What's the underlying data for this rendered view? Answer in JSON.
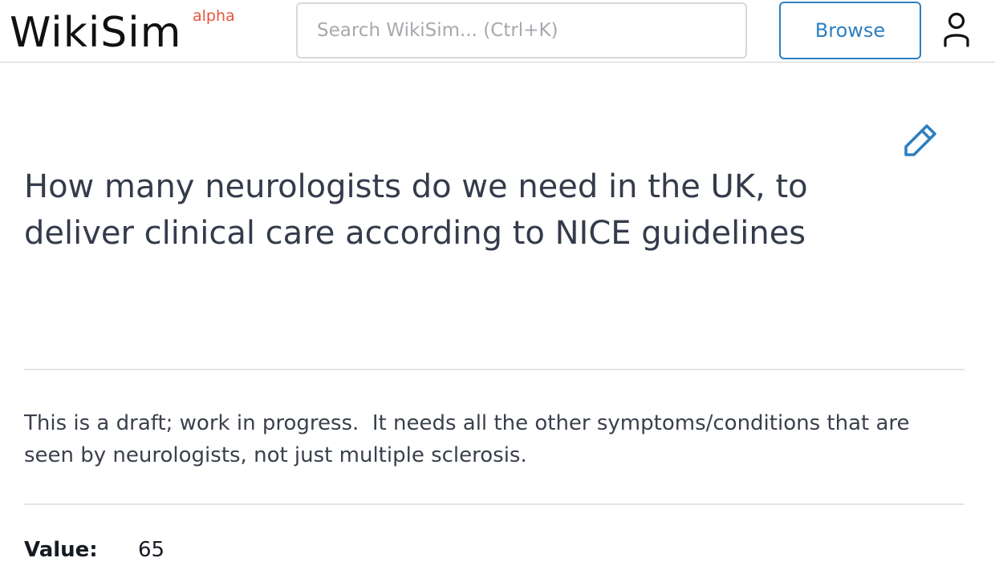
{
  "header": {
    "logo_text": "WikiSim",
    "logo_badge": "alpha",
    "search_placeholder": "Search WikiSim... (Ctrl+K)",
    "browse_label": "Browse",
    "user_icon": "user-icon",
    "accent_color": "#2e7fbf",
    "badge_color": "#e8553e"
  },
  "page": {
    "edit_icon": "pencil-icon",
    "title": "How many neurologists do we need in the UK, to deliver clinical care according to NICE guidelines",
    "description": "This is a draft; work in progress.  It needs all the other symptoms/conditions that are seen by neurologists, not just multiple sclerosis.",
    "value_label": "Value:",
    "value": "65"
  }
}
